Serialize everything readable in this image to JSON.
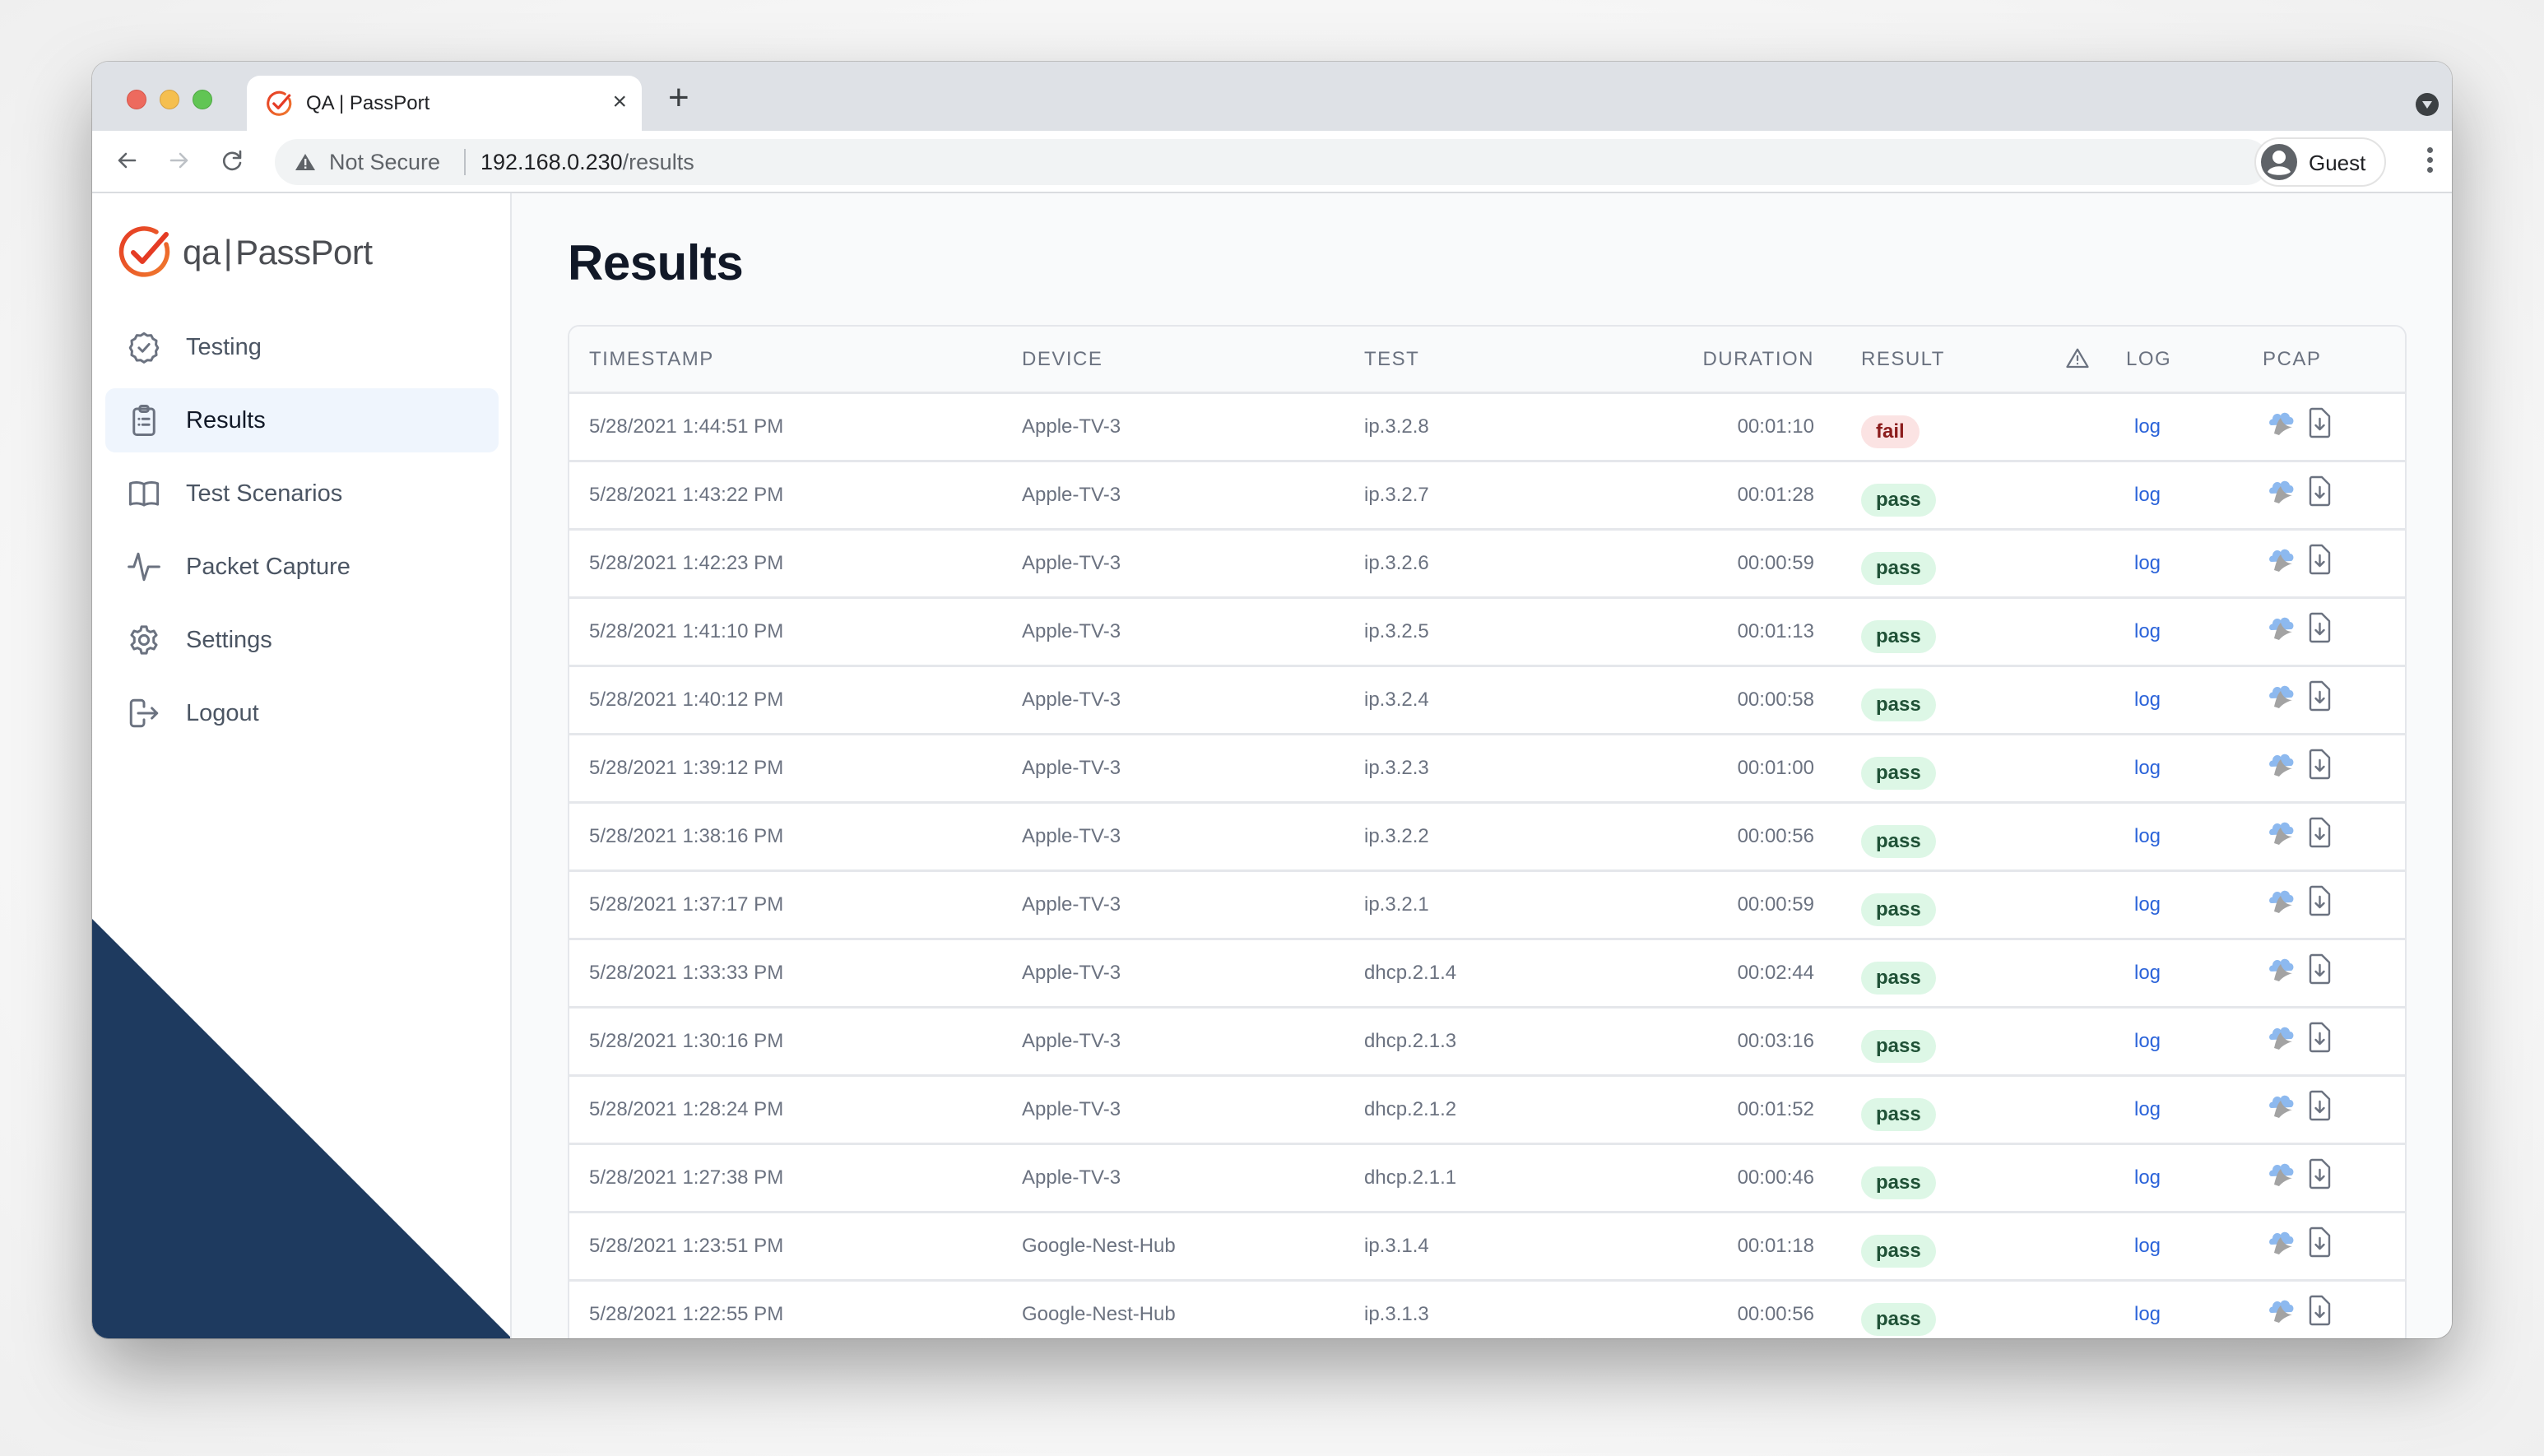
{
  "browser": {
    "tab_title": "QA | PassPort",
    "tab_close": "×",
    "new_tab": "+",
    "security_label": "Not Secure",
    "url_host": "192.168.0.230",
    "url_path": "/results",
    "profile_label": "Guest"
  },
  "sidebar": {
    "logo_prefix": "qa",
    "logo_separator": "|",
    "logo_name": "PassPort",
    "items": [
      {
        "label": "Testing",
        "icon": "badge-check-icon",
        "active": false
      },
      {
        "label": "Results",
        "icon": "clipboard-list-icon",
        "active": true
      },
      {
        "label": "Test Scenarios",
        "icon": "book-open-icon",
        "active": false
      },
      {
        "label": "Packet Capture",
        "icon": "activity-pulse-icon",
        "active": false
      },
      {
        "label": "Settings",
        "icon": "gear-icon",
        "active": false
      },
      {
        "label": "Logout",
        "icon": "logout-icon",
        "active": false
      }
    ],
    "accent_color": "#1e3a5f"
  },
  "main": {
    "title": "Results",
    "table": {
      "headers": {
        "timestamp": "TIMESTAMP",
        "device": "DEVICE",
        "test": "TEST",
        "duration": "DURATION",
        "result": "RESULT",
        "warnings_icon": "warning-triangle-icon",
        "log": "LOG",
        "pcap": "PCAP"
      },
      "rows": [
        {
          "timestamp": "5/28/2021 1:44:51 PM",
          "device": "Apple-TV-3",
          "test": "ip.3.2.8",
          "duration": "00:01:10",
          "result": "fail",
          "log": "log"
        },
        {
          "timestamp": "5/28/2021 1:43:22 PM",
          "device": "Apple-TV-3",
          "test": "ip.3.2.7",
          "duration": "00:01:28",
          "result": "pass",
          "log": "log"
        },
        {
          "timestamp": "5/28/2021 1:42:23 PM",
          "device": "Apple-TV-3",
          "test": "ip.3.2.6",
          "duration": "00:00:59",
          "result": "pass",
          "log": "log"
        },
        {
          "timestamp": "5/28/2021 1:41:10 PM",
          "device": "Apple-TV-3",
          "test": "ip.3.2.5",
          "duration": "00:01:13",
          "result": "pass",
          "log": "log"
        },
        {
          "timestamp": "5/28/2021 1:40:12 PM",
          "device": "Apple-TV-3",
          "test": "ip.3.2.4",
          "duration": "00:00:58",
          "result": "pass",
          "log": "log"
        },
        {
          "timestamp": "5/28/2021 1:39:12 PM",
          "device": "Apple-TV-3",
          "test": "ip.3.2.3",
          "duration": "00:01:00",
          "result": "pass",
          "log": "log"
        },
        {
          "timestamp": "5/28/2021 1:38:16 PM",
          "device": "Apple-TV-3",
          "test": "ip.3.2.2",
          "duration": "00:00:56",
          "result": "pass",
          "log": "log"
        },
        {
          "timestamp": "5/28/2021 1:37:17 PM",
          "device": "Apple-TV-3",
          "test": "ip.3.2.1",
          "duration": "00:00:59",
          "result": "pass",
          "log": "log"
        },
        {
          "timestamp": "5/28/2021 1:33:33 PM",
          "device": "Apple-TV-3",
          "test": "dhcp.2.1.4",
          "duration": "00:02:44",
          "result": "pass",
          "log": "log"
        },
        {
          "timestamp": "5/28/2021 1:30:16 PM",
          "device": "Apple-TV-3",
          "test": "dhcp.2.1.3",
          "duration": "00:03:16",
          "result": "pass",
          "log": "log"
        },
        {
          "timestamp": "5/28/2021 1:28:24 PM",
          "device": "Apple-TV-3",
          "test": "dhcp.2.1.2",
          "duration": "00:01:52",
          "result": "pass",
          "log": "log"
        },
        {
          "timestamp": "5/28/2021 1:27:38 PM",
          "device": "Apple-TV-3",
          "test": "dhcp.2.1.1",
          "duration": "00:00:46",
          "result": "pass",
          "log": "log"
        },
        {
          "timestamp": "5/28/2021 1:23:51 PM",
          "device": "Google-Nest-Hub",
          "test": "ip.3.1.4",
          "duration": "00:01:18",
          "result": "pass",
          "log": "log"
        },
        {
          "timestamp": "5/28/2021 1:22:55 PM",
          "device": "Google-Nest-Hub",
          "test": "ip.3.1.3",
          "duration": "00:00:56",
          "result": "pass",
          "log": "log"
        }
      ]
    },
    "colors": {
      "fail_bg": "#fbe3e3",
      "fail_text": "#8b1c1c",
      "pass_bg": "#ddf7e6",
      "pass_text": "#1f5136",
      "link": "#2b63d9"
    }
  }
}
